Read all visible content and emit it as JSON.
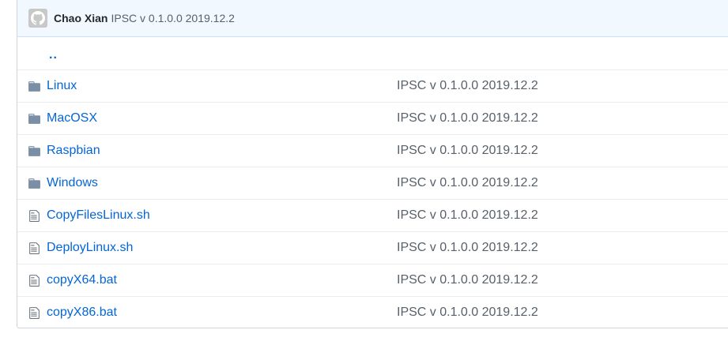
{
  "commit": {
    "author": "Chao Xian",
    "message": "IPSC v 0.1.0.0 2019.12.2"
  },
  "parent_link": "..",
  "files": [
    {
      "name": "Linux",
      "type": "folder",
      "message": "IPSC v 0.1.0.0 2019.12.2"
    },
    {
      "name": "MacOSX",
      "type": "folder",
      "message": "IPSC v 0.1.0.0 2019.12.2"
    },
    {
      "name": "Raspbian",
      "type": "folder",
      "message": "IPSC v 0.1.0.0 2019.12.2"
    },
    {
      "name": "Windows",
      "type": "folder",
      "message": "IPSC v 0.1.0.0 2019.12.2"
    },
    {
      "name": "CopyFilesLinux.sh",
      "type": "file",
      "message": "IPSC v 0.1.0.0 2019.12.2"
    },
    {
      "name": "DeployLinux.sh",
      "type": "file",
      "message": "IPSC v 0.1.0.0 2019.12.2"
    },
    {
      "name": "copyX64.bat",
      "type": "file",
      "message": "IPSC v 0.1.0.0 2019.12.2"
    },
    {
      "name": "copyX86.bat",
      "type": "file",
      "message": "IPSC v 0.1.0.0 2019.12.2"
    }
  ],
  "colors": {
    "link": "#0366d6",
    "header_bg": "#f1f8ff",
    "folder_icon": "#79b8ff",
    "muted_text": "#586069"
  },
  "icons": {
    "avatar": "github-octocat-icon",
    "folder": "folder-icon",
    "file": "file-text-icon"
  }
}
